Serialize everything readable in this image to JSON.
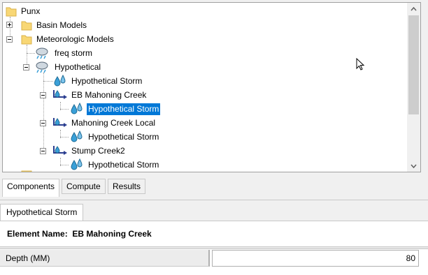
{
  "tree": {
    "root": "Punx",
    "basin_models": "Basin Models",
    "meteorologic_models": "Meteorologic Models",
    "freq_storm": "freq storm",
    "hypothetical": "Hypothetical",
    "hypothetical_storm": "Hypothetical Storm",
    "subbasins": [
      {
        "name": "EB Mahoning Creek",
        "child": "Hypothetical Storm",
        "selected": true
      },
      {
        "name": "Mahoning Creek Local",
        "child": "Hypothetical Storm"
      },
      {
        "name": "Stump Creek2",
        "child": "Hypothetical Storm"
      }
    ]
  },
  "tabs": [
    "Components",
    "Compute",
    "Results"
  ],
  "editor": {
    "tab_label": "Hypothetical Storm",
    "element_name_label": "Element Name:",
    "element_name_value": "EB Mahoning Creek",
    "fields": [
      {
        "label": "Depth (MM)",
        "value": "80"
      }
    ]
  },
  "colors": {
    "selection": "#0078d7",
    "folder": "#f8d775",
    "drop": "#3aa0d8"
  }
}
